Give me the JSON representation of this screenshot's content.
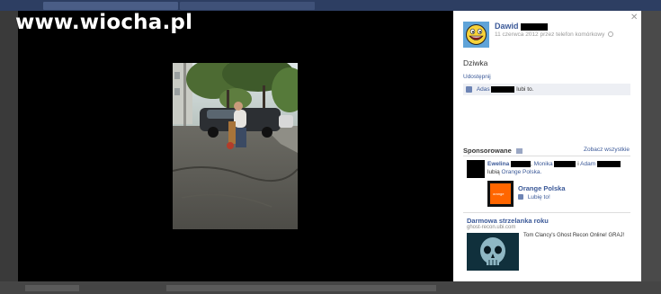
{
  "watermark": "www.wiocha.pl",
  "post": {
    "author": "Dawid",
    "meta": "11 czerwca 2012 przez telefon komórkowy",
    "caption": "Dziwka",
    "share_label": "Udostępnij",
    "likes_name": "Adas",
    "likes_suffix": "lubi to."
  },
  "sponsored": {
    "title": "Sponsorowane",
    "see_all": "Zobacz wszystkie",
    "friend1": "Ewelina",
    "friend2": "Monika",
    "friend_sep": "i",
    "friend3": "Adam",
    "likes_prefix": "lubią",
    "page_link": "Orange Polska.",
    "page_name": "Orange Polska",
    "page_like": "Lubię to!",
    "logo_word": "orange",
    "ad_title": "Darmowa strzelanka roku",
    "ad_url": "ghost-recon.ubi.com",
    "ad_body": "Tom Clancy's Ghost Recon Online! GRAJ!"
  },
  "colors": {
    "fb_link": "#3b5998",
    "orange": "#ff6600"
  }
}
